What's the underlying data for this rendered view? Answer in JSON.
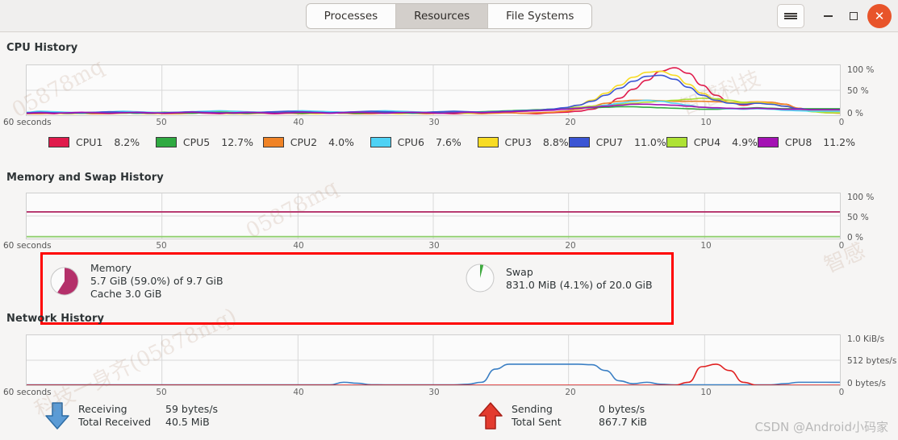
{
  "window": {
    "tabs": [
      {
        "label": "Processes",
        "active": false
      },
      {
        "label": "Resources",
        "active": true
      },
      {
        "label": "File Systems",
        "active": false
      }
    ],
    "menu_icon": "hamburger-icon",
    "minimize_icon": "minimize-icon",
    "maximize_icon": "maximize-icon",
    "close_icon": "close-icon",
    "close_color": "#e8542a"
  },
  "cpu": {
    "title": "CPU History",
    "x_label": "60 seconds",
    "x_ticks": [
      "50",
      "40",
      "30",
      "20",
      "10",
      "0"
    ],
    "y_ticks": [
      "100 %",
      "50 %",
      "0 %"
    ],
    "legend": [
      {
        "name": "CPU1",
        "value": "8.2%",
        "color": "#e01b4c"
      },
      {
        "name": "CPU5",
        "value": "12.7%",
        "color": "#2faa41"
      },
      {
        "name": "CPU2",
        "value": "4.0%",
        "color": "#f08326"
      },
      {
        "name": "CPU6",
        "value": "7.6%",
        "color": "#4fd2f5"
      },
      {
        "name": "CPU3",
        "value": "8.8%",
        "color": "#f8dc24"
      },
      {
        "name": "CPU7",
        "value": "11.0%",
        "color": "#3b55d4"
      },
      {
        "name": "CPU4",
        "value": "4.9%",
        "color": "#aee234"
      },
      {
        "name": "CPU8",
        "value": "11.2%",
        "color": "#a412b4"
      }
    ]
  },
  "memory": {
    "title": "Memory and Swap History",
    "x_label": "60 seconds",
    "x_ticks": [
      "50",
      "40",
      "30",
      "20",
      "10",
      "0"
    ],
    "y_ticks": [
      "100 %",
      "50 %",
      "0 %"
    ],
    "memory_card": {
      "name": "Memory",
      "usage": "5.7 GiB (59.0%) of 9.7 GiB",
      "cache": "Cache 3.0 GiB",
      "color": "#b4306a",
      "percent": 59.0
    },
    "swap_card": {
      "name": "Swap",
      "usage": "831.0 MiB (4.1%) of 20.0 GiB",
      "color": "#3fa93f",
      "percent": 4.1
    }
  },
  "network": {
    "title": "Network History",
    "x_label": "60 seconds",
    "x_ticks": [
      "50",
      "40",
      "30",
      "20",
      "10",
      "0"
    ],
    "y_ticks": [
      "1.0 KiB/s",
      "512 bytes/s",
      "0 bytes/s"
    ],
    "receiving": {
      "arrow_icon": "download-arrow-icon",
      "rate_label": "Receiving",
      "rate_value": "59 bytes/s",
      "total_label": "Total Received",
      "total_value": "40.5 MiB",
      "color": "#3b7fc4"
    },
    "sending": {
      "arrow_icon": "upload-arrow-icon",
      "rate_label": "Sending",
      "rate_value": "0 bytes/s",
      "total_label": "Total Sent",
      "total_value": "867.7 KiB",
      "color": "#e02020"
    }
  },
  "annotation": {
    "box_color": "#ff0000"
  },
  "watermarks": {
    "csdn": "CSDN @Android小码家",
    "marks": [
      "05878mq",
      "智感科技",
      "05878mq",
      "智感",
      "科技一身齐(05878mq)"
    ]
  },
  "chart_data": [
    {
      "type": "line",
      "title": "CPU History",
      "xlabel": "60 seconds",
      "ylabel": "%",
      "ylim": [
        0,
        100
      ],
      "x_ticks": [
        60,
        50,
        40,
        30,
        20,
        10,
        0
      ],
      "y_ticks": [
        0,
        50,
        100
      ],
      "grid": true,
      "legend_position": "below",
      "series": [
        {
          "name": "CPU1",
          "color": "#e01b4c",
          "current": 8.2,
          "values": [
            3,
            4,
            3,
            5,
            4,
            3,
            4,
            5,
            4,
            3,
            4,
            6,
            5,
            4,
            3,
            4,
            5,
            4,
            3,
            4,
            5,
            6,
            5,
            4,
            3,
            4,
            5,
            4,
            6,
            5,
            4,
            3,
            4,
            5,
            6,
            5,
            4,
            3,
            5,
            6,
            8,
            12,
            20,
            34,
            52,
            70,
            88,
            95,
            84,
            60,
            40,
            26,
            20,
            24,
            26,
            22,
            14,
            9,
            8,
            8
          ]
        },
        {
          "name": "CPU2",
          "color": "#f08326",
          "current": 4.0,
          "values": [
            3,
            3,
            4,
            3,
            4,
            3,
            3,
            4,
            5,
            4,
            3,
            3,
            4,
            5,
            4,
            3,
            3,
            4,
            5,
            4,
            3,
            4,
            5,
            4,
            3,
            3,
            4,
            5,
            4,
            3,
            4,
            5,
            4,
            3,
            4,
            5,
            4,
            5,
            6,
            8,
            12,
            18,
            24,
            28,
            30,
            30,
            29,
            28,
            28,
            28,
            27,
            26,
            26,
            27,
            26,
            22,
            14,
            8,
            5,
            4
          ]
        },
        {
          "name": "CPU3",
          "color": "#f8dc24",
          "current": 8.8,
          "values": [
            4,
            5,
            4,
            3,
            4,
            5,
            6,
            5,
            4,
            3,
            4,
            5,
            6,
            5,
            4,
            3,
            4,
            5,
            6,
            5,
            4,
            3,
            4,
            5,
            6,
            5,
            4,
            3,
            4,
            5,
            6,
            5,
            4,
            5,
            6,
            7,
            8,
            9,
            11,
            14,
            20,
            30,
            44,
            60,
            76,
            86,
            88,
            80,
            62,
            44,
            32,
            26,
            24,
            26,
            24,
            18,
            12,
            9,
            9,
            9
          ]
        },
        {
          "name": "CPU4",
          "color": "#aee234",
          "current": 4.9,
          "values": [
            5,
            6,
            5,
            4,
            5,
            6,
            5,
            4,
            5,
            6,
            5,
            4,
            5,
            6,
            7,
            6,
            5,
            4,
            5,
            6,
            7,
            6,
            5,
            4,
            5,
            6,
            7,
            6,
            5,
            6,
            7,
            6,
            5,
            6,
            7,
            8,
            9,
            10,
            12,
            14,
            16,
            18,
            20,
            22,
            24,
            26,
            28,
            30,
            32,
            34,
            33,
            30,
            26,
            24,
            22,
            18,
            12,
            7,
            5,
            5
          ]
        },
        {
          "name": "CPU5",
          "color": "#2faa41",
          "current": 12.7,
          "values": [
            4,
            5,
            6,
            5,
            4,
            5,
            6,
            5,
            4,
            5,
            6,
            5,
            4,
            5,
            6,
            5,
            4,
            5,
            6,
            5,
            4,
            5,
            6,
            5,
            4,
            5,
            6,
            5,
            4,
            5,
            6,
            5,
            6,
            7,
            8,
            9,
            10,
            11,
            12,
            13,
            14,
            15,
            16,
            17,
            17,
            16,
            15,
            14,
            13,
            12,
            12,
            13,
            14,
            15,
            14,
            13,
            13,
            13,
            13,
            13
          ]
        },
        {
          "name": "CPU6",
          "color": "#4fd2f5",
          "current": 7.6,
          "values": [
            6,
            8,
            7,
            6,
            5,
            6,
            7,
            8,
            7,
            6,
            5,
            6,
            7,
            8,
            9,
            8,
            7,
            6,
            7,
            8,
            9,
            8,
            7,
            6,
            7,
            8,
            9,
            8,
            7,
            6,
            7,
            8,
            7,
            6,
            7,
            8,
            9,
            10,
            11,
            12,
            14,
            16,
            20,
            24,
            28,
            30,
            28,
            24,
            20,
            16,
            14,
            13,
            12,
            13,
            12,
            10,
            9,
            8,
            8,
            8
          ]
        },
        {
          "name": "CPU7",
          "color": "#3b55d4",
          "current": 11.0,
          "values": [
            5,
            6,
            5,
            4,
            5,
            6,
            7,
            6,
            5,
            4,
            5,
            6,
            7,
            6,
            5,
            4,
            5,
            6,
            7,
            8,
            7,
            6,
            5,
            6,
            7,
            8,
            7,
            6,
            5,
            6,
            7,
            8,
            7,
            6,
            7,
            8,
            9,
            10,
            12,
            15,
            20,
            28,
            40,
            54,
            68,
            78,
            80,
            72,
            56,
            40,
            30,
            24,
            22,
            24,
            22,
            18,
            13,
            11,
            11,
            11
          ]
        },
        {
          "name": "CPU8",
          "color": "#a412b4",
          "current": 11.2,
          "values": [
            4,
            5,
            4,
            5,
            6,
            5,
            4,
            5,
            6,
            5,
            4,
            5,
            6,
            5,
            4,
            5,
            6,
            5,
            4,
            5,
            6,
            5,
            4,
            5,
            6,
            5,
            4,
            5,
            6,
            5,
            4,
            5,
            6,
            5,
            6,
            7,
            8,
            9,
            10,
            12,
            14,
            16,
            18,
            20,
            22,
            22,
            21,
            20,
            18,
            16,
            15,
            14,
            13,
            14,
            13,
            12,
            12,
            11,
            11,
            11
          ]
        }
      ]
    },
    {
      "type": "line",
      "title": "Memory and Swap History",
      "xlabel": "60 seconds",
      "ylabel": "%",
      "ylim": [
        0,
        100
      ],
      "x_ticks": [
        60,
        50,
        40,
        30,
        20,
        10,
        0
      ],
      "y_ticks": [
        0,
        50,
        100
      ],
      "grid": true,
      "series": [
        {
          "name": "Memory",
          "color": "#b4306a",
          "current": 59.0,
          "constant": 59.0
        },
        {
          "name": "Swap",
          "color": "#8fce6e",
          "current": 4.1,
          "constant": 4.1
        }
      ]
    },
    {
      "type": "line",
      "title": "Network History",
      "xlabel": "60 seconds",
      "ylabel": "bytes/s",
      "ylim": [
        0,
        1024
      ],
      "x_ticks": [
        60,
        50,
        40,
        30,
        20,
        10,
        0
      ],
      "y_ticks": [
        0,
        512,
        1024
      ],
      "grid": true,
      "series": [
        {
          "name": "Receiving",
          "color": "#3b7fc4",
          "values": [
            8,
            8,
            8,
            8,
            8,
            8,
            8,
            8,
            8,
            8,
            8,
            8,
            8,
            8,
            8,
            8,
            8,
            8,
            8,
            8,
            8,
            8,
            8,
            60,
            40,
            10,
            8,
            8,
            8,
            8,
            8,
            8,
            20,
            60,
            330,
            430,
            430,
            430,
            430,
            430,
            430,
            420,
            300,
            90,
            30,
            60,
            20,
            8,
            8,
            8,
            8,
            8,
            8,
            8,
            8,
            30,
            60,
            60,
            60,
            59
          ]
        },
        {
          "name": "Sending",
          "color": "#e02020",
          "values": [
            0,
            0,
            0,
            0,
            0,
            0,
            0,
            0,
            0,
            0,
            0,
            0,
            0,
            0,
            0,
            0,
            0,
            0,
            0,
            0,
            0,
            0,
            0,
            0,
            0,
            0,
            0,
            0,
            0,
            0,
            0,
            0,
            0,
            0,
            0,
            0,
            0,
            0,
            0,
            0,
            0,
            0,
            0,
            0,
            0,
            0,
            0,
            0,
            60,
            380,
            430,
            300,
            60,
            0,
            0,
            0,
            0,
            0,
            0,
            0
          ]
        }
      ]
    }
  ]
}
